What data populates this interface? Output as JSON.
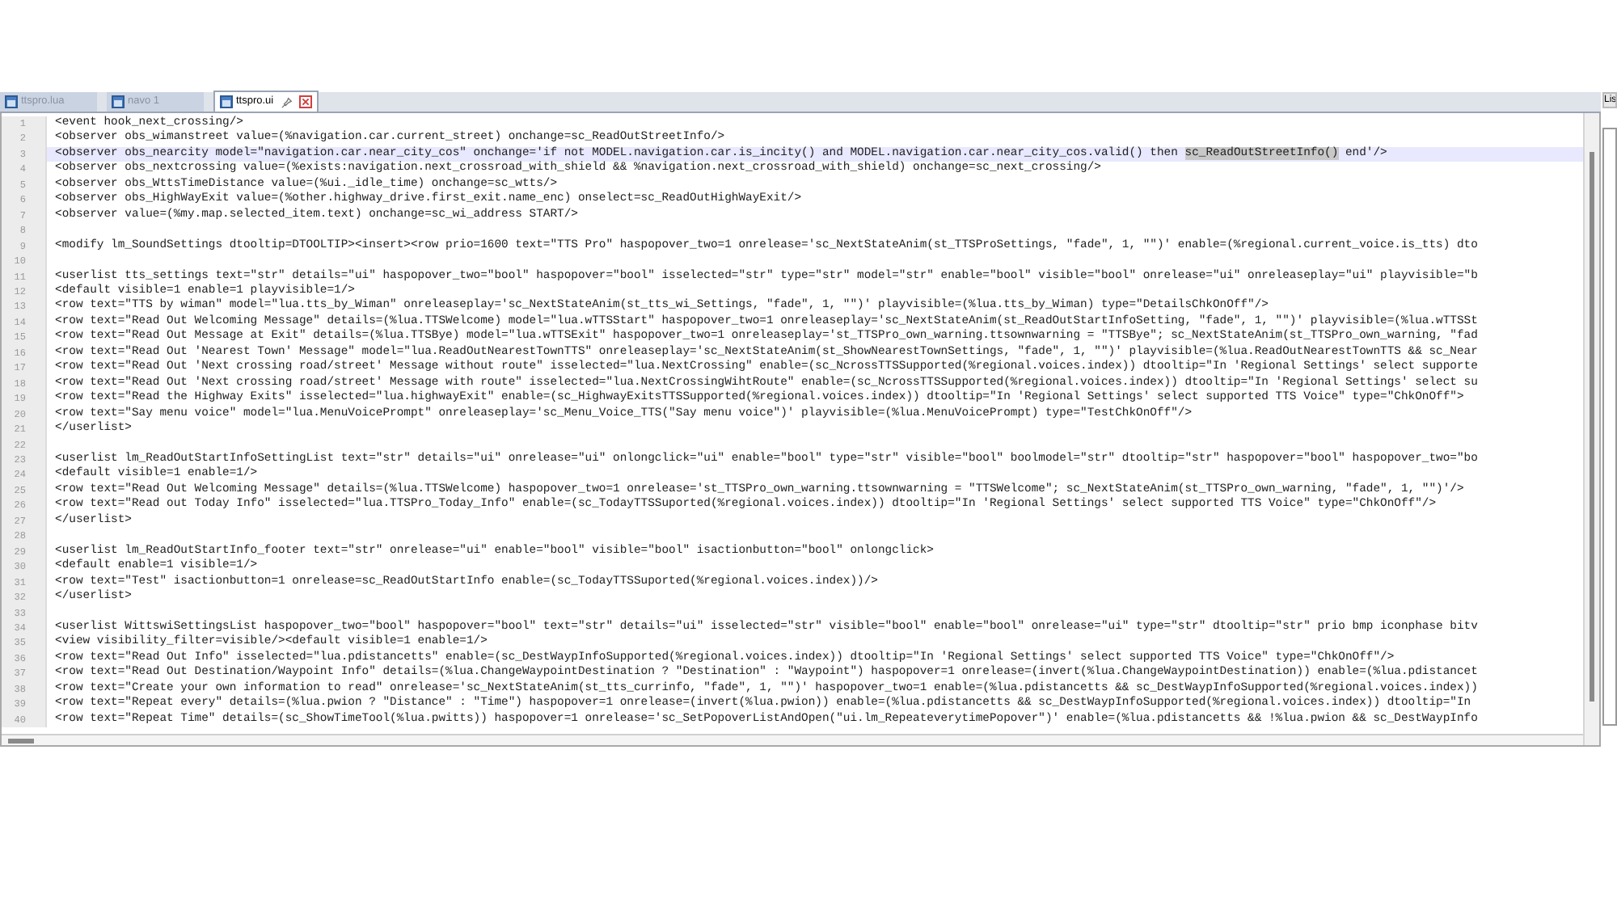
{
  "tabs": [
    {
      "label": "ttspro.lua",
      "selected": false
    },
    {
      "label": "navo 1",
      "selected": false
    },
    {
      "label": "ttspro.ui",
      "selected": true
    }
  ],
  "side_panel": {
    "title": "Lis"
  },
  "lines": [
    {
      "number": "1",
      "current": false,
      "parts": [
        {
          "text": "<event hook_next_crossing/>",
          "highlighted": false
        }
      ]
    },
    {
      "number": "2",
      "current": false,
      "parts": [
        {
          "text": "<observer obs_wimanstreet value=(%navigation.car.current_street) onchange=sc_ReadOutStreetInfo/>",
          "highlighted": false
        }
      ]
    },
    {
      "number": "3",
      "current": true,
      "parts": [
        {
          "text": "<observer obs_nearcity model=\"navigation.car.near_city_cos\" onchange='if not MODEL.navigation.car.is_incity() and MODEL.navigation.car.near_city_cos.valid() then ",
          "highlighted": false
        },
        {
          "text": "sc_ReadOutStreetInfo()",
          "highlighted": true
        },
        {
          "text": " end'/>",
          "highlighted": false
        }
      ]
    },
    {
      "number": "4",
      "current": false,
      "parts": [
        {
          "text": "<observer obs_nextcrossing value=(%exists:navigation.next_crossroad_with_shield && %navigation.next_crossroad_with_shield) onchange=sc_next_crossing/>",
          "highlighted": false
        }
      ]
    },
    {
      "number": "5",
      "current": false,
      "parts": [
        {
          "text": "<observer obs_WttsTimeDistance value=(%ui._idle_time) onchange=sc_wtts/>",
          "highlighted": false
        }
      ]
    },
    {
      "number": "6",
      "current": false,
      "parts": [
        {
          "text": "<observer obs_HighWayExit value=(%other.highway_drive.first_exit.name_enc) onselect=sc_ReadOutHighWayExit/>",
          "highlighted": false
        }
      ]
    },
    {
      "number": "7",
      "current": false,
      "parts": [
        {
          "text": "<observer value=(%my.map.selected_item.text) onchange=sc_wi_address START/>",
          "highlighted": false
        }
      ]
    },
    {
      "number": "8",
      "current": false
    },
    {
      "number": "9",
      "current": false,
      "parts": [
        {
          "text": "<modify lm_SoundSettings dtooltip=DTOOLTIP><insert><row prio=1600 text=\"TTS Pro\" haspopover_two=1 onrelease='sc_NextStateAnim(st_TTSProSettings, \"fade\", 1, \"\")' enable=(%regional.current_voice.is_tts) dto",
          "highlighted": false
        }
      ]
    },
    {
      "number": "10",
      "current": false
    },
    {
      "number": "11",
      "current": false,
      "parts": [
        {
          "text": "<userlist tts_settings text=\"str\" details=\"ui\" haspopover_two=\"bool\" haspopover=\"bool\" isselected=\"str\" type=\"str\" model=\"str\" enable=\"bool\" visible=\"bool\" onrelease=\"ui\" onreleaseplay=\"ui\" playvisible=\"b",
          "highlighted": false
        }
      ]
    },
    {
      "number": "12",
      "current": false,
      "parts": [
        {
          "text": "<default visible=1 enable=1 playvisible=1/>",
          "highlighted": false
        }
      ]
    },
    {
      "number": "13",
      "current": false,
      "parts": [
        {
          "text": "<row text=\"TTS by wiman\" model=\"lua.tts_by_Wiman\" onreleaseplay='sc_NextStateAnim(st_tts_wi_Settings, \"fade\", 1, \"\")' playvisible=(%lua.tts_by_Wiman) type=\"DetailsChkOnOff\"/>",
          "highlighted": false
        }
      ]
    },
    {
      "number": "14",
      "current": false,
      "parts": [
        {
          "text": "<row text=\"Read Out Welcoming Message\" details=(%lua.TTSWelcome) model=\"lua.wTTSStart\" haspopover_two=1 onreleaseplay='sc_NextStateAnim(st_ReadOutStartInfoSetting, \"fade\", 1, \"\")' playvisible=(%lua.wTTSSt",
          "highlighted": false
        }
      ]
    },
    {
      "number": "15",
      "current": false,
      "parts": [
        {
          "text": "<row text=\"Read Out Message at Exit\" details=(%lua.TTSBye) model=\"lua.wTTSExit\" haspopover_two=1 onreleaseplay='st_TTSPro_own_warning.ttsownwarning = \"TTSBye\"; sc_NextStateAnim(st_TTSPro_own_warning, \"fad",
          "highlighted": false
        }
      ]
    },
    {
      "number": "16",
      "current": false,
      "parts": [
        {
          "text": "<row text=\"Read Out 'Nearest Town' Message\" model=\"lua.ReadOutNearestTownTTS\" onreleaseplay='sc_NextStateAnim(st_ShowNearestTownSettings, \"fade\", 1, \"\")' playvisible=(%lua.ReadOutNearestTownTTS && sc_Near",
          "highlighted": false
        }
      ]
    },
    {
      "number": "17",
      "current": false,
      "parts": [
        {
          "text": "<row text=\"Read Out 'Next crossing road/street' Message without route\" isselected=\"lua.NextCrossing\" enable=(sc_NcrossTTSSupported(%regional.voices.index)) dtooltip=\"In 'Regional Settings' select supporte",
          "highlighted": false
        }
      ]
    },
    {
      "number": "18",
      "current": false,
      "parts": [
        {
          "text": "<row text=\"Read Out 'Next crossing road/street' Message with route\" isselected=\"lua.NextCrossingWihtRoute\" enable=(sc_NcrossTTSSupported(%regional.voices.index)) dtooltip=\"In 'Regional Settings' select su",
          "highlighted": false
        }
      ]
    },
    {
      "number": "19",
      "current": false,
      "parts": [
        {
          "text": "<row text=\"Read the Highway Exits\" isselected=\"lua.highwayExit\" enable=(sc_HighwayExitsTTSSupported(%regional.voices.index)) dtooltip=\"In 'Regional Settings' select supported TTS Voice\" type=\"ChkOnOff\">",
          "highlighted": false
        }
      ]
    },
    {
      "number": "20",
      "current": false,
      "parts": [
        {
          "text": "<row text=\"Say menu voice\" model=\"lua.MenuVoicePrompt\" onreleaseplay='sc_Menu_Voice_TTS(\"Say menu voice\")' playvisible=(%lua.MenuVoicePrompt) type=\"TestChkOnOff\"/>",
          "highlighted": false
        }
      ]
    },
    {
      "number": "21",
      "current": false,
      "parts": [
        {
          "text": "</userlist>",
          "highlighted": false
        }
      ]
    },
    {
      "number": "22",
      "current": false
    },
    {
      "number": "23",
      "current": false,
      "parts": [
        {
          "text": "<userlist lm_ReadOutStartInfoSettingList text=\"str\" details=\"ui\" onrelease=\"ui\" onlongclick=\"ui\" enable=\"bool\" type=\"str\" visible=\"bool\" boolmodel=\"str\" dtooltip=\"str\" haspopover=\"bool\" haspopover_two=\"bo",
          "highlighted": false
        }
      ]
    },
    {
      "number": "24",
      "current": false,
      "parts": [
        {
          "text": "<default visible=1 enable=1/>",
          "highlighted": false
        }
      ]
    },
    {
      "number": "25",
      "current": false,
      "parts": [
        {
          "text": "<row text=\"Read Out Welcoming Message\" details=(%lua.TTSWelcome) haspopover_two=1 onrelease='st_TTSPro_own_warning.ttsownwarning = \"TTSWelcome\"; sc_NextStateAnim(st_TTSPro_own_warning, \"fade\", 1, \"\")'/>",
          "highlighted": false
        }
      ]
    },
    {
      "number": "26",
      "current": false,
      "parts": [
        {
          "text": "<row text=\"Read out Today Info\" isselected=\"lua.TTSPro_Today_Info\" enable=(sc_TodayTTSSuported(%regional.voices.index)) dtooltip=\"In 'Regional Settings' select supported TTS Voice\" type=\"ChkOnOff\"/>",
          "highlighted": false
        }
      ]
    },
    {
      "number": "27",
      "current": false,
      "parts": [
        {
          "text": "</userlist>",
          "highlighted": false
        }
      ]
    },
    {
      "number": "28",
      "current": false
    },
    {
      "number": "29",
      "current": false,
      "parts": [
        {
          "text": "<userlist lm_ReadOutStartInfo_footer text=\"str\" onrelease=\"ui\" enable=\"bool\" visible=\"bool\" isactionbutton=\"bool\" onlongclick>",
          "highlighted": false
        }
      ]
    },
    {
      "number": "30",
      "current": false,
      "parts": [
        {
          "text": "<default enable=1 visible=1/>",
          "highlighted": false
        }
      ]
    },
    {
      "number": "31",
      "current": false,
      "parts": [
        {
          "text": "<row text=\"Test\" isactionbutton=1 onrelease=sc_ReadOutStartInfo enable=(sc_TodayTTSSuported(%regional.voices.index))/>",
          "highlighted": false
        }
      ]
    },
    {
      "number": "32",
      "current": false,
      "parts": [
        {
          "text": "</userlist>",
          "highlighted": false
        }
      ]
    },
    {
      "number": "33",
      "current": false
    },
    {
      "number": "34",
      "current": false,
      "parts": [
        {
          "text": "<userlist WittswiSettingsList haspopover_two=\"bool\" haspopover=\"bool\" text=\"str\" details=\"ui\" isselected=\"str\" visible=\"bool\" enable=\"bool\" onrelease=\"ui\" type=\"str\" dtooltip=\"str\" prio bmp iconphase bitv",
          "highlighted": false
        }
      ]
    },
    {
      "number": "35",
      "current": false,
      "parts": [
        {
          "text": "<view visibility_filter=visible/><default visible=1 enable=1/>",
          "highlighted": false
        }
      ]
    },
    {
      "number": "36",
      "current": false,
      "parts": [
        {
          "text": "<row text=\"Read Out Info\" isselected=\"lua.pdistancetts\" enable=(sc_DestWaypInfoSupported(%regional.voices.index)) dtooltip=\"In 'Regional Settings' select supported TTS Voice\" type=\"ChkOnOff\"/>",
          "highlighted": false
        }
      ]
    },
    {
      "number": "37",
      "current": false,
      "parts": [
        {
          "text": "<row text=\"Read Out Destination/Waypoint Info\" details=(%lua.ChangeWaypointDestination ? \"Destination\" : \"Waypoint\") haspopover=1 onrelease=(invert(%lua.ChangeWaypointDestination)) enable=(%lua.pdistancet",
          "highlighted": false
        }
      ]
    },
    {
      "number": "38",
      "current": false,
      "parts": [
        {
          "text": "<row text=\"Create your own information to read\" onrelease='sc_NextStateAnim(st_tts_currinfo, \"fade\", 1, \"\")' haspopover_two=1 enable=(%lua.pdistancetts && sc_DestWaypInfoSupported(%regional.voices.index))",
          "highlighted": false
        }
      ]
    },
    {
      "number": "39",
      "current": false,
      "parts": [
        {
          "text": "<row text=\"Repeat every\" details=(%lua.pwion ? \"Distance\" : \"Time\") haspopover=1 onrelease=(invert(%lua.pwion)) enable=(%lua.pdistancetts && sc_DestWaypInfoSupported(%regional.voices.index)) dtooltip=\"In",
          "highlighted": false
        }
      ]
    },
    {
      "number": "40",
      "current": false,
      "parts": [
        {
          "text": "<row text=\"Repeat Time\" details=(sc_ShowTimeTool(%lua.pwitts)) haspopover=1 onrelease='sc_SetPopoverListAndOpen(\"ui.lm_RepeateverytimePopover\")' enable=(%lua.pdistancetts && !%lua.pwion && sc_DestWaypInfo",
          "highlighted": false
        }
      ]
    }
  ]
}
